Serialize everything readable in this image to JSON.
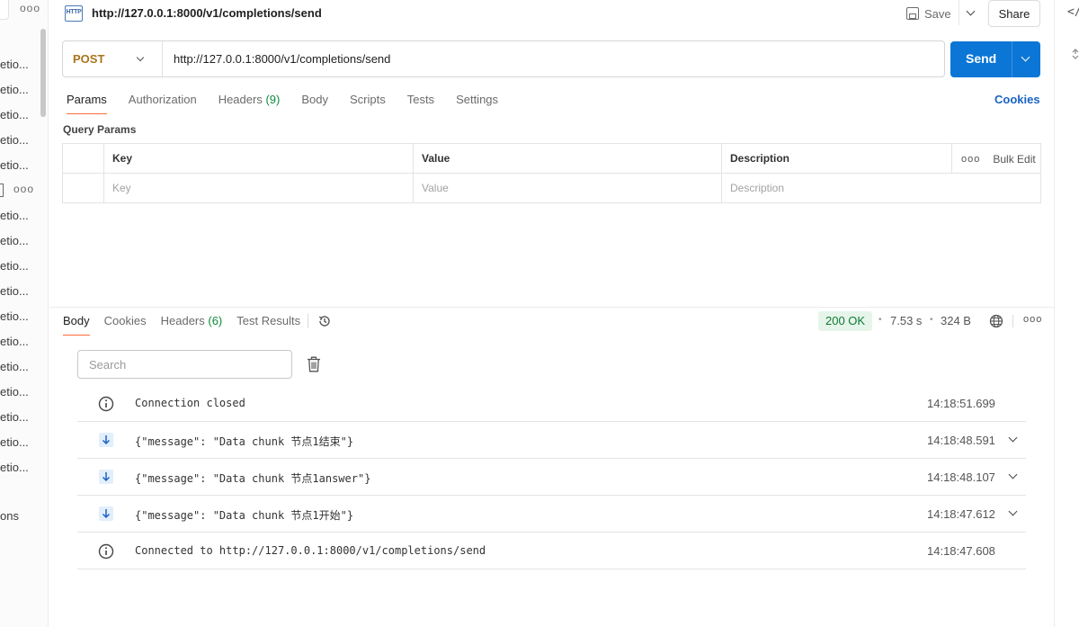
{
  "sidebar": {
    "top_more": "ooo",
    "items": [
      "etio...",
      "etio...",
      "etio...",
      "etio...",
      "etio...",
      "etio...",
      "etio...",
      "etio...",
      "etio...",
      "etio...",
      "etio...",
      "etio...",
      "etio...",
      "etio...",
      "etio...",
      "etio..."
    ],
    "special_more": "ooo",
    "last_item": "ons"
  },
  "header": {
    "icon_text": "HTTP",
    "title": "http://127.0.0.1:8000/v1/completions/send",
    "save_label": "Save",
    "share_label": "Share"
  },
  "request": {
    "method": "POST",
    "url": "http://127.0.0.1:8000/v1/completions/send",
    "send_label": "Send",
    "tabs": [
      {
        "label": "Params",
        "count": ""
      },
      {
        "label": "Authorization",
        "count": ""
      },
      {
        "label": "Headers",
        "count": "(9)"
      },
      {
        "label": "Body",
        "count": ""
      },
      {
        "label": "Scripts",
        "count": ""
      },
      {
        "label": "Tests",
        "count": ""
      },
      {
        "label": "Settings",
        "count": ""
      }
    ],
    "cookies_label": "Cookies",
    "query_params_title": "Query Params",
    "table": {
      "headers": [
        "Key",
        "Value",
        "Description"
      ],
      "bulk_edit": "Bulk Edit",
      "more": "ooo",
      "placeholders": [
        "Key",
        "Value",
        "Description"
      ]
    }
  },
  "response": {
    "tabs": [
      {
        "label": "Body",
        "count": ""
      },
      {
        "label": "Cookies",
        "count": ""
      },
      {
        "label": "Headers",
        "count": "(6)"
      },
      {
        "label": "Test Results",
        "count": ""
      }
    ],
    "status": "200 OK",
    "time": "7.53 s",
    "size": "324 B",
    "more": "ooo",
    "search_placeholder": "Search",
    "messages": [
      {
        "type": "info",
        "text": "Connection closed",
        "time": "14:18:51.699",
        "expandable": false
      },
      {
        "type": "incoming",
        "text": "{\"message\": \"Data chunk 节点1结束\"}",
        "time": "14:18:48.591",
        "expandable": true
      },
      {
        "type": "incoming",
        "text": "{\"message\": \"Data chunk 节点1answer\"}",
        "time": "14:18:48.107",
        "expandable": true
      },
      {
        "type": "incoming",
        "text": "{\"message\": \"Data chunk 节点1开始\"}",
        "time": "14:18:47.612",
        "expandable": true
      },
      {
        "type": "info",
        "text": "Connected to http://127.0.0.1:8000/v1/completions/send",
        "time": "14:18:47.608",
        "expandable": false
      }
    ]
  },
  "right_rail": {
    "code_glyph": "</"
  },
  "colors": {
    "accent_orange": "#ff6c37",
    "send_blue": "#0b76d6",
    "status_green": "#0f7a35",
    "method_post": "#a8751b",
    "link_blue": "#1a63c4"
  }
}
